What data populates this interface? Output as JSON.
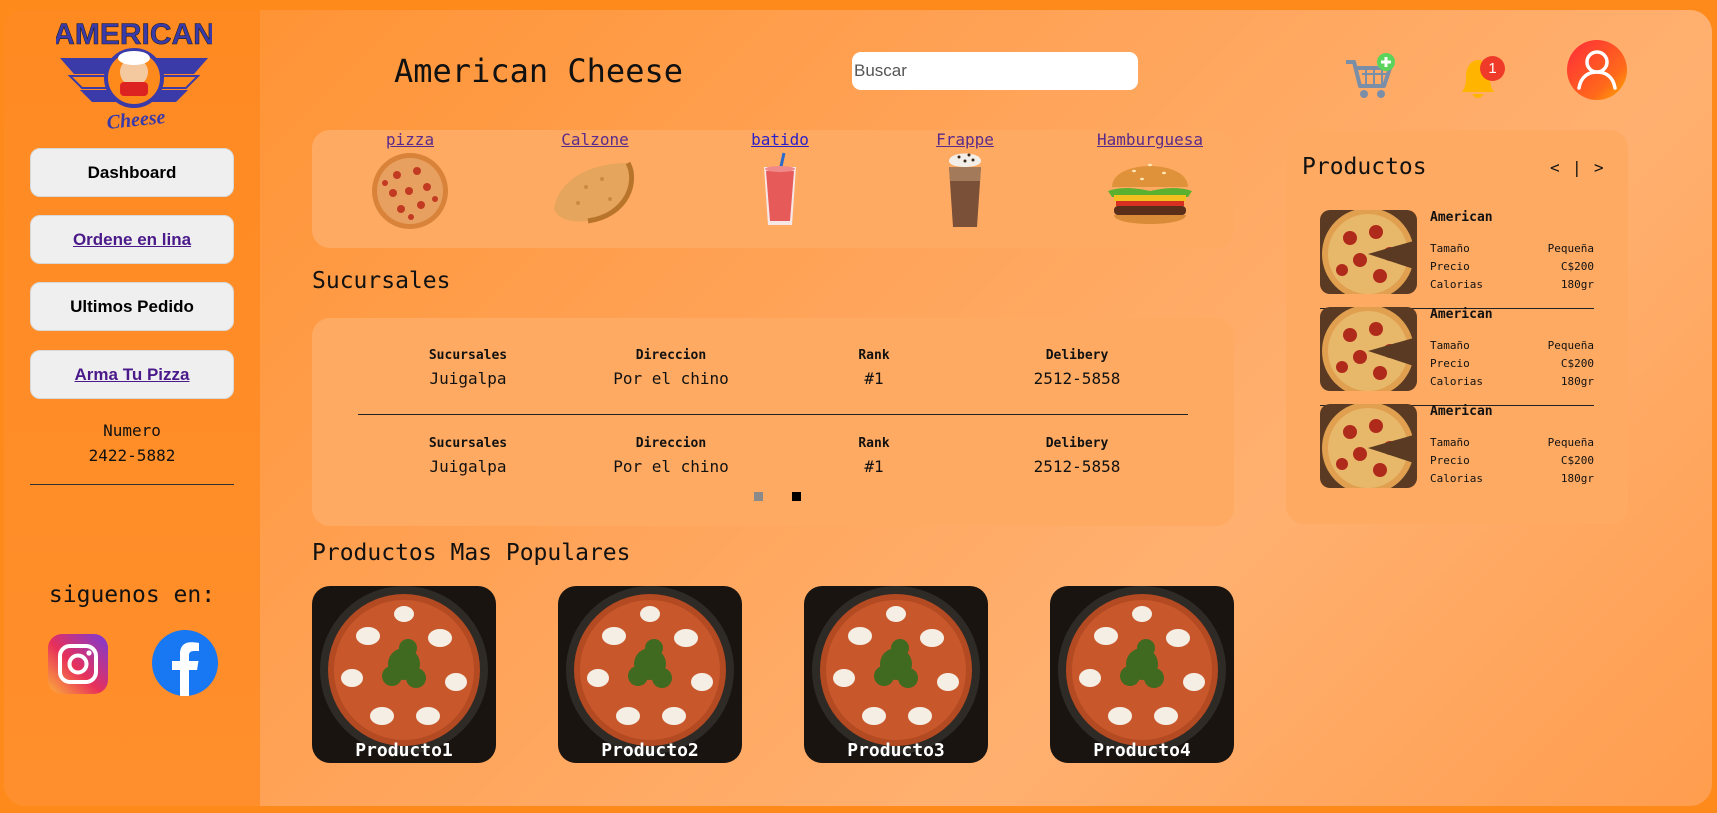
{
  "logo": {
    "line1": "AMERICAN",
    "line2": "Cheese"
  },
  "sidebar": {
    "buttons": [
      {
        "label": "Dashboard",
        "link": false
      },
      {
        "label": "Ordene en lina",
        "link": true
      },
      {
        "label": "Ultimos Pedido",
        "link": false
      },
      {
        "label": "Arma Tu Pizza",
        "link": true
      }
    ],
    "numero_label": "Numero",
    "numero_value": "2422-5882",
    "siguenos": "siguenos en:"
  },
  "header": {
    "title": "American Cheese",
    "search_placeholder": "Buscar",
    "notification_count": "1"
  },
  "categories": [
    {
      "label": "pizza",
      "icon": "pizza-icon"
    },
    {
      "label": "Calzone",
      "icon": "calzone-icon"
    },
    {
      "label": "batido",
      "icon": "smoothie-icon"
    },
    {
      "label": "Frappe",
      "icon": "frappe-icon"
    },
    {
      "label": "Hamburguesa",
      "icon": "burger-icon"
    }
  ],
  "sucursales": {
    "title": "Sucursales",
    "rows": [
      {
        "headers": [
          "Sucursales",
          "Direccion",
          "Rank",
          "Delibery"
        ],
        "values": [
          "Juigalpa",
          "Por el chino",
          "#1",
          "2512-5858"
        ]
      },
      {
        "headers": [
          "Sucursales",
          "Direccion",
          "Rank",
          "Delibery"
        ],
        "values": [
          "Juigalpa",
          "Por el chino",
          "#1",
          "2512-5858"
        ]
      }
    ]
  },
  "populares": {
    "title": "Productos Mas Populares",
    "items": [
      "Producto1",
      "Producto2",
      "Producto3",
      "Producto4"
    ]
  },
  "productos_panel": {
    "title": "Productos",
    "prev": "<",
    "sep": "|",
    "next": ">",
    "items": [
      {
        "name": "American",
        "size_label": "Tamaño",
        "size": "Pequeña",
        "price_label": "Precio",
        "price": "C$200",
        "cal_label": "Calorias",
        "cal": "180gr"
      },
      {
        "name": "American",
        "size_label": "Tamaño",
        "size": "Pequeña",
        "price_label": "Precio",
        "price": "C$200",
        "cal_label": "Calorias",
        "cal": "180gr"
      },
      {
        "name": "American",
        "size_label": "Tamaño",
        "size": "Pequeña",
        "price_label": "Precio",
        "price": "C$200",
        "cal_label": "Calorias",
        "cal": "180gr"
      }
    ]
  },
  "colors": {
    "accent": "#ff8a1c",
    "panel": "#ffaa62",
    "link": "#4b1a8a"
  }
}
